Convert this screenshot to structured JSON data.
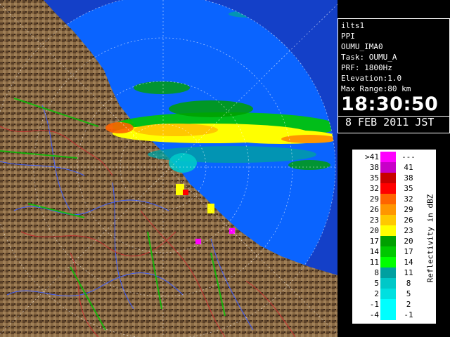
{
  "info": {
    "radar_id": "ilts1",
    "scan_mode": "PPI",
    "product": "OUMU_IMA0",
    "task": "Task: OUMU_A",
    "prf": "PRF: 1800Hz",
    "elevation": "Elevation:1.0",
    "max_range": "Max Range:80 km",
    "time": "18:30:50",
    "date": "8 FEB 2011 JST"
  },
  "legend": {
    "unit_label": "Reflectivity in dBZ",
    "bins": [
      {
        "low": ">41",
        "high": "---",
        "color": "#ff00ff"
      },
      {
        "low": "38",
        "high": "41",
        "color": "#c800c8"
      },
      {
        "low": "35",
        "high": "38",
        "color": "#c80000"
      },
      {
        "low": "32",
        "high": "35",
        "color": "#ff0000"
      },
      {
        "low": "29",
        "high": "32",
        "color": "#ff6400"
      },
      {
        "low": "26",
        "high": "29",
        "color": "#ff9600"
      },
      {
        "low": "23",
        "high": "26",
        "color": "#ffc800"
      },
      {
        "low": "20",
        "high": "23",
        "color": "#ffff00"
      },
      {
        "low": "17",
        "high": "20",
        "color": "#00a000"
      },
      {
        "low": "14",
        "high": "17",
        "color": "#00c800"
      },
      {
        "low": "11",
        "high": "14",
        "color": "#00ff00"
      },
      {
        "low": "8",
        "high": "11",
        "color": "#00a0a0"
      },
      {
        "low": "5",
        "high": "8",
        "color": "#00c8c8"
      },
      {
        "low": "2",
        "high": "5",
        "color": "#00e0e0"
      },
      {
        "low": "-1",
        "high": "2",
        "color": "#00ffff"
      },
      {
        "low": "-4",
        "high": "-1",
        "color": "#00ffff"
      }
    ]
  },
  "colors": {
    "ocean_outside": "#1440c8",
    "ocean_inside": "#0a64ff",
    "land": "#8a6a44",
    "range_ring": "#ffffff",
    "rivers": "#4060ff",
    "boundaries": "#c83030"
  }
}
